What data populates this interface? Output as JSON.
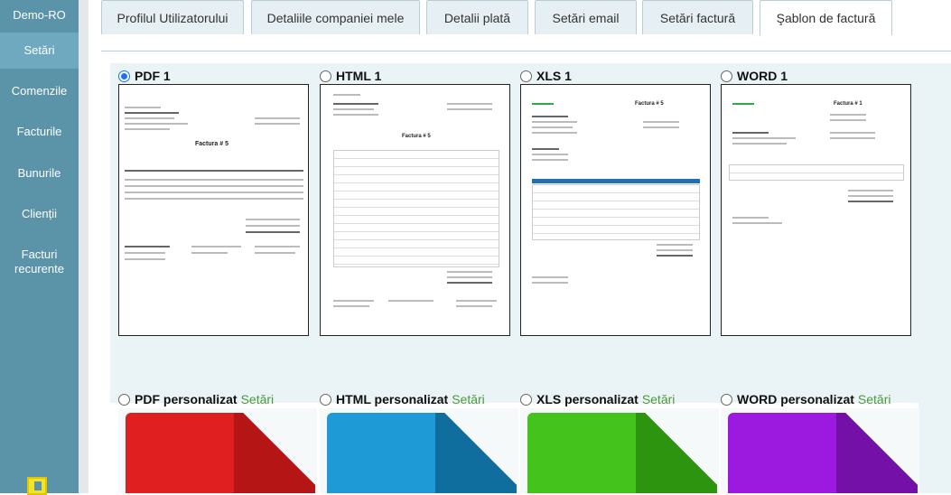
{
  "sidebar": {
    "brand": "Demo-RO",
    "items": [
      {
        "label": "Setări",
        "active": true
      },
      {
        "label": "Comenzile"
      },
      {
        "label": "Facturile"
      },
      {
        "label": "Bunurile"
      },
      {
        "label": "Clienții"
      },
      {
        "label": "Facturi recurente"
      }
    ],
    "exit_icon": "exit-icon"
  },
  "tabs": [
    {
      "label": "Profilul Utilizatorului"
    },
    {
      "label": "Detaliile companiei mele"
    },
    {
      "label": "Detalii plată"
    },
    {
      "label": "Setări email"
    },
    {
      "label": "Setări factură"
    },
    {
      "label": "Şablon de factură",
      "active": true
    }
  ],
  "templates": [
    {
      "label": "PDF 1",
      "checked": true
    },
    {
      "label": "HTML 1"
    },
    {
      "label": "XLS 1"
    },
    {
      "label": "WORD 1"
    }
  ],
  "custom_templates": [
    {
      "label": "PDF personalizat",
      "link": "Setări",
      "color": "#e02020",
      "fold": "#b51515"
    },
    {
      "label": "HTML personalizat",
      "link": "Setări",
      "color": "#1e9bd7",
      "fold": "#0f6e9e"
    },
    {
      "label": "XLS personalizat",
      "link": "Setări",
      "color": "#45c31d",
      "fold": "#2d9410"
    },
    {
      "label": "WORD personalizat",
      "link": "Setări",
      "color": "#9c19e0",
      "fold": "#7410a8"
    }
  ],
  "thumb_text": {
    "pdf_title": "Factura # 5",
    "html_title": "Factura # 5",
    "xls_title": "Factura # 5",
    "word_title": "Factura # 1"
  }
}
